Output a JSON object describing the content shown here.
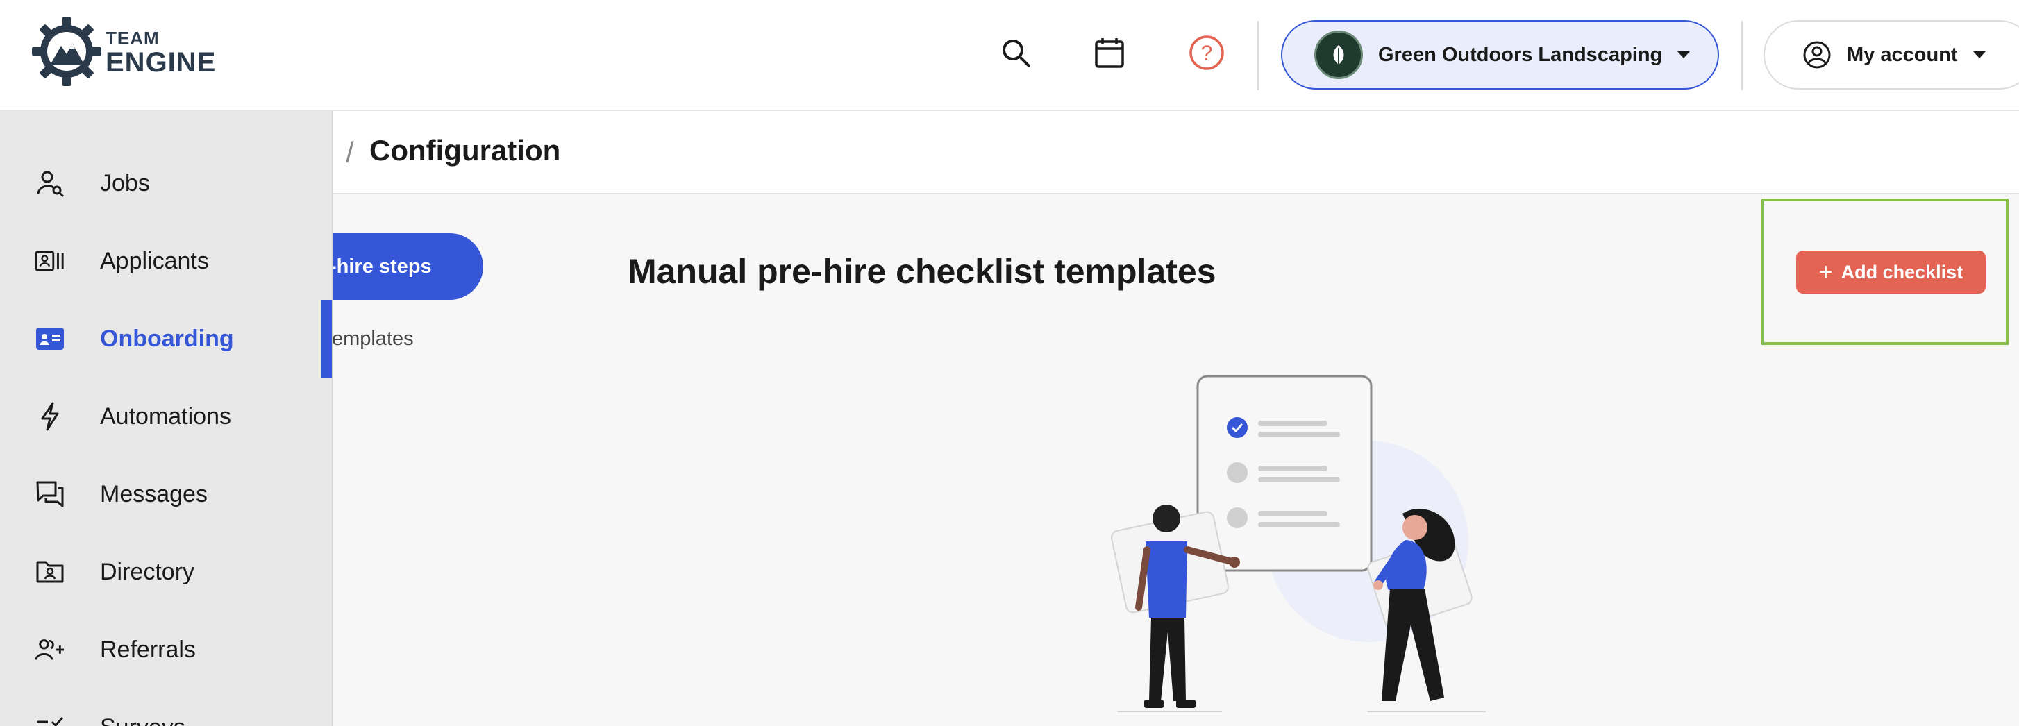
{
  "brand": {
    "line1": "TEAM",
    "line2": "ENGINE"
  },
  "header": {
    "icons": [
      "search-icon",
      "calendar-icon",
      "help-icon"
    ],
    "company_name": "Green Outdoors Landscaping",
    "account_label": "My account"
  },
  "breadcrumb": {
    "previous_fragment": "‹",
    "separator": "/",
    "current": "Configuration"
  },
  "subnav": {
    "active_label": "-hire steps",
    "link_label": "emplates"
  },
  "sidebar": {
    "items": [
      {
        "label": "Jobs",
        "icon": "jobs-icon"
      },
      {
        "label": "Applicants",
        "icon": "applicants-icon"
      },
      {
        "label": "Onboarding",
        "icon": "onboarding-icon",
        "active": true
      },
      {
        "label": "Automations",
        "icon": "lightning-icon"
      },
      {
        "label": "Messages",
        "icon": "messages-icon"
      },
      {
        "label": "Directory",
        "icon": "directory-icon"
      },
      {
        "label": "Referrals",
        "icon": "referrals-icon"
      },
      {
        "label": "Surveys",
        "icon": "surveys-icon"
      }
    ]
  },
  "main": {
    "title": "Manual pre-hire checklist templates",
    "add_button_label": "Add checklist"
  },
  "colors": {
    "accent": "#3556d6",
    "button": "#e36452",
    "highlight": "#86bd4c"
  }
}
